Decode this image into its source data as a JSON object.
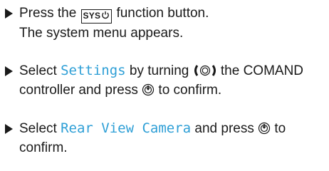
{
  "steps": [
    {
      "before": "Press the ",
      "key_label": "SYS",
      "after": " function button.",
      "result": "The system menu appears."
    },
    {
      "before": "Select ",
      "term": "Settings",
      "middle": " by turning ",
      "after_turn": " the COMAND controller and press ",
      "after_press": " to confirm."
    },
    {
      "before": "Select ",
      "term": "Rear View Camera",
      "middle": " and press ",
      "after_press": " to confirm."
    }
  ],
  "colors": {
    "text": "#1a1a1a",
    "ui_term": "#2e9fd6"
  },
  "icons": [
    "bullet-triangle-icon",
    "power-icon",
    "turn-controller-icon",
    "press-controller-icon"
  ]
}
